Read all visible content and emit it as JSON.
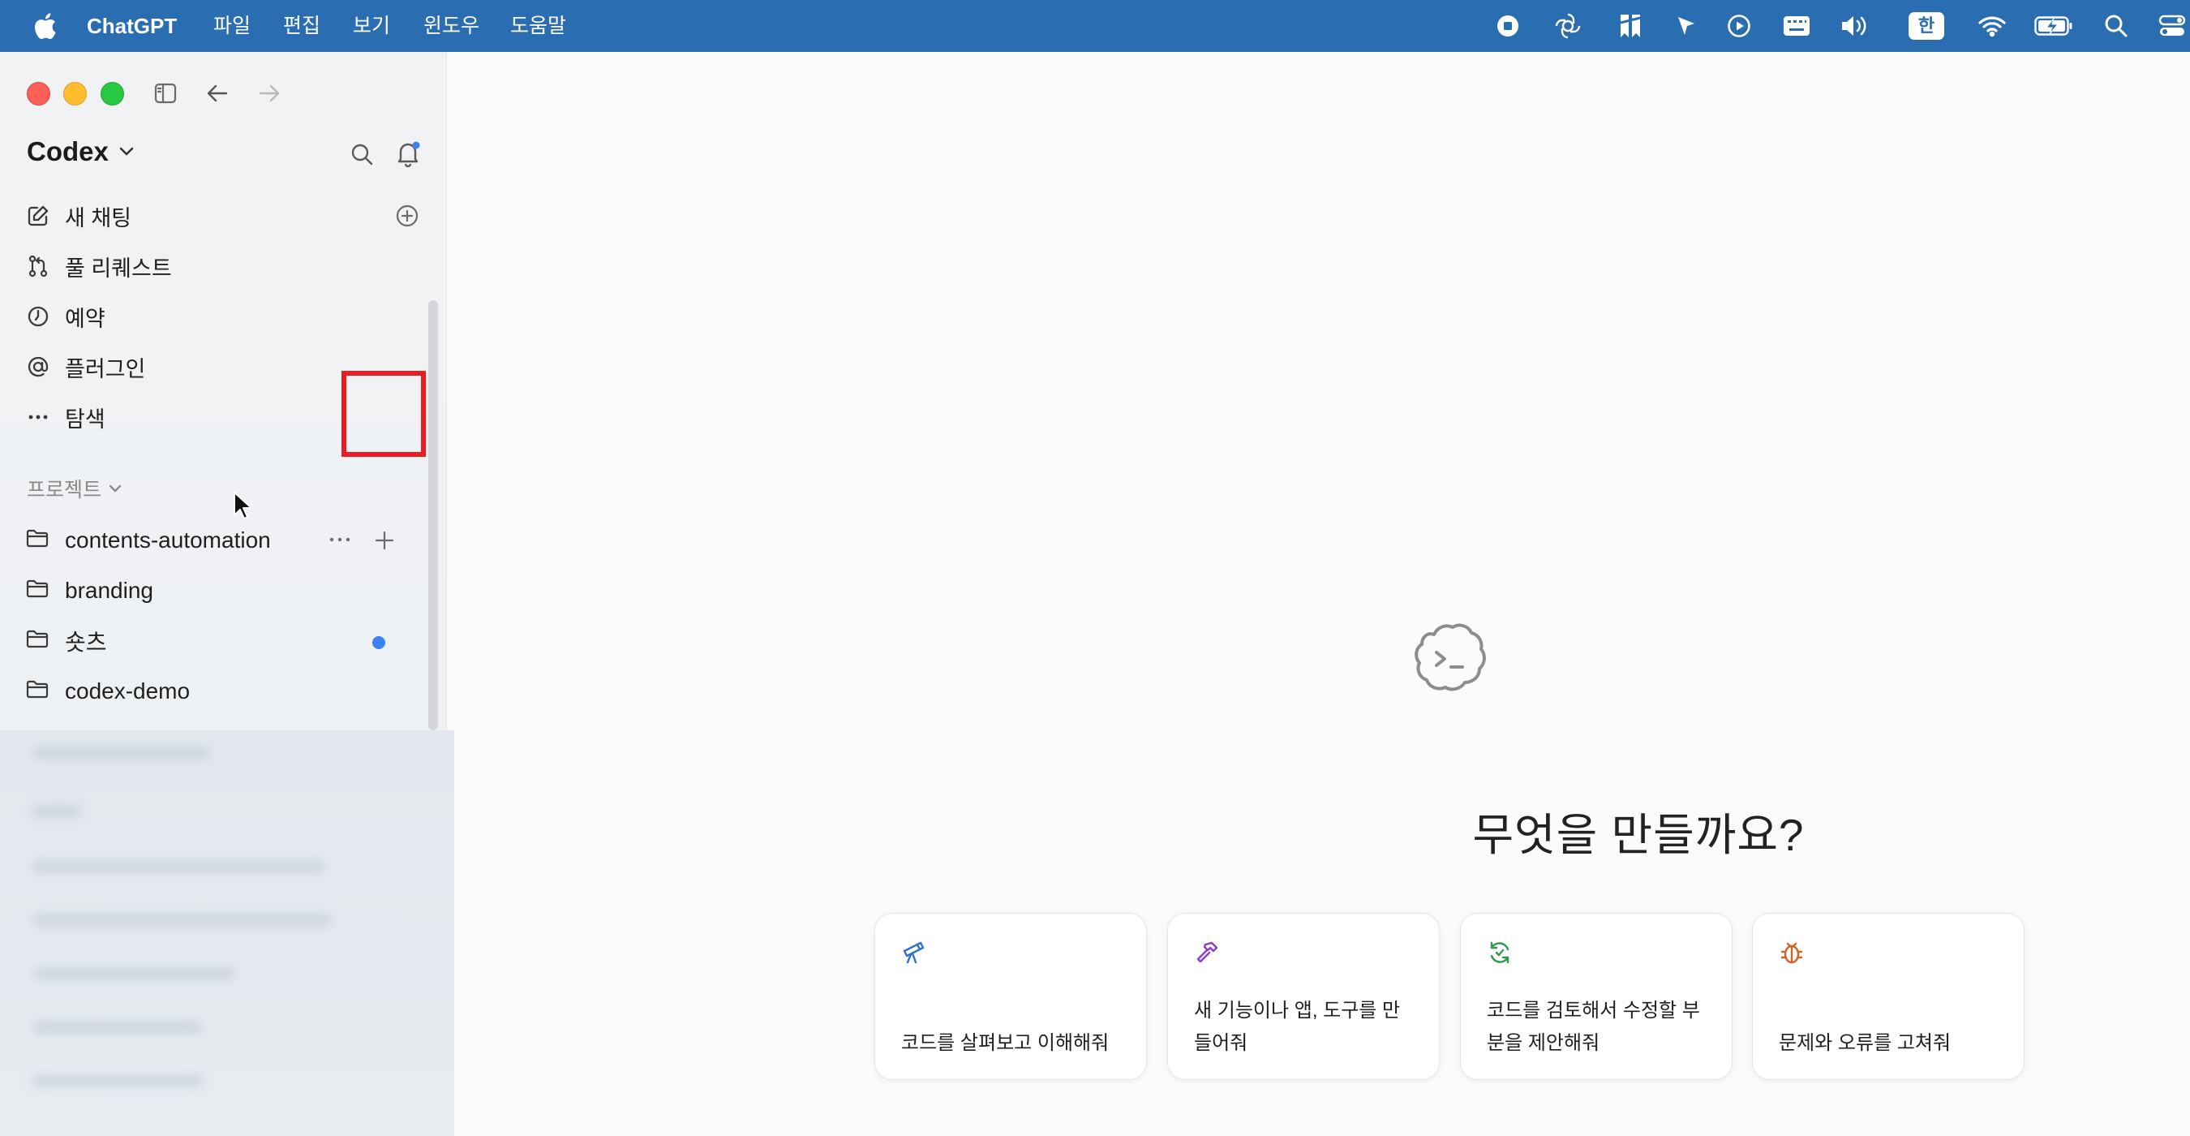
{
  "menubar": {
    "app_name": "ChatGPT",
    "menus": [
      "파일",
      "편집",
      "보기",
      "윈도우",
      "도움말"
    ],
    "ime_label": "한",
    "status_icons": [
      "stop-record-icon",
      "openai-icon",
      "bookmark-app-icon",
      "location-arrow-icon",
      "play-circle-icon",
      "keyboard-icon",
      "volume-icon",
      "ime-icon",
      "wifi-icon",
      "battery-charging-icon",
      "spotlight-search-icon",
      "control-center-icon"
    ]
  },
  "sidebar": {
    "title": "Codex",
    "nav": [
      {
        "label": "새 채팅",
        "icon": "compose-icon"
      },
      {
        "label": "풀 리퀘스트",
        "icon": "pull-request-icon"
      },
      {
        "label": "예약",
        "icon": "clock-icon"
      },
      {
        "label": "플러그인",
        "icon": "at-sign-icon"
      },
      {
        "label": "탐색",
        "icon": "ellipsis-icon"
      }
    ],
    "projects_label": "프로젝트",
    "projects": [
      {
        "label": "contents-automation",
        "unread": false
      },
      {
        "label": "branding",
        "unread": true
      },
      {
        "label": "숏츠",
        "unread": false
      },
      {
        "label": "codex-demo",
        "unread": false
      }
    ]
  },
  "main": {
    "title": "무엇을 만들까요?",
    "cards": [
      {
        "text": "코드를 살펴보고 이해해줘",
        "icon": "telescope-icon",
        "color": "#2f6fce"
      },
      {
        "text": "새 기능이나 앱, 도구를 만들어줘",
        "icon": "hammer-icon",
        "color": "#8a3fc7"
      },
      {
        "text": "코드를 검토해서 수정할 부분을 제안해줘",
        "icon": "refresh-check-icon",
        "color": "#2f9a4f"
      },
      {
        "text": "문제와 오류를 고쳐줘",
        "icon": "bug-icon",
        "color": "#d0612a"
      }
    ]
  },
  "colors": {
    "menubar_bg": "#2a6db0",
    "highlight": "#ea1c24",
    "unread_dot": "#3b82f6"
  }
}
